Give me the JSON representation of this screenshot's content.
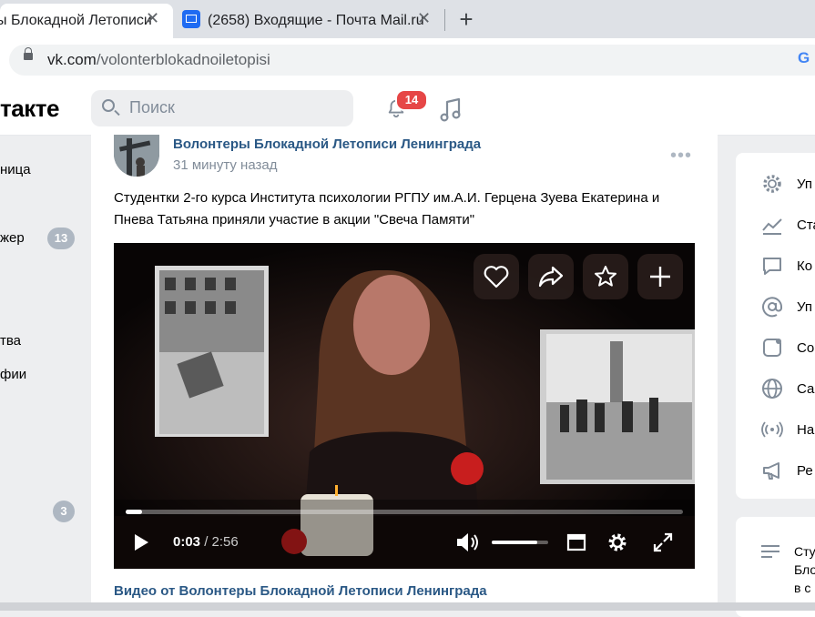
{
  "browser": {
    "tabs": [
      {
        "title": "ы Блокадной Летописи",
        "active": true
      },
      {
        "title": "(2658) Входящие - Почта Mail.ru",
        "active": false
      }
    ],
    "new_tab": "+",
    "url_host": "vk.com",
    "url_path": "/volonterblokadnoiletopisi",
    "google_letter": "G"
  },
  "header": {
    "logo": "такте",
    "search_placeholder": "Поиск",
    "notifications_count": "14"
  },
  "sidebar": {
    "items": [
      {
        "label": "ница"
      },
      {
        "label": "жер",
        "count": "13"
      },
      {
        "label": "тва"
      },
      {
        "label": "фии"
      }
    ],
    "bottom_count": "3"
  },
  "post": {
    "author": "Волонтеры Блокадной Летописи Ленинграда",
    "time": "31 минуту назад",
    "more": "•••",
    "text": "Студентки 2-го курса Института психологии РГПУ им.А.И. Герцена Зуева Екатерина и Пнева Татьяна приняли участие в акции \"Свеча Памяти\"",
    "video": {
      "current_time": "0:03",
      "separator": " / ",
      "duration": "2:56",
      "progress": 0.03,
      "volume": 0.8
    },
    "video_source": "Видео от Волонтеры Блокадной Летописи Ленинграда"
  },
  "right_menu": {
    "items": [
      {
        "icon": "gear-icon",
        "label": "Уп"
      },
      {
        "icon": "stats-icon",
        "label": "Ста"
      },
      {
        "icon": "comment-icon",
        "label": "Ко"
      },
      {
        "icon": "at-icon",
        "label": "Уп"
      },
      {
        "icon": "message-icon",
        "label": "Со"
      },
      {
        "icon": "globe-icon",
        "label": "Са"
      },
      {
        "icon": "broadcast-icon",
        "label": "На"
      },
      {
        "icon": "megaphone-icon",
        "label": "Ре"
      }
    ]
  },
  "right_panel2": {
    "lines": [
      "Сту",
      "Бло",
      "в с"
    ]
  }
}
